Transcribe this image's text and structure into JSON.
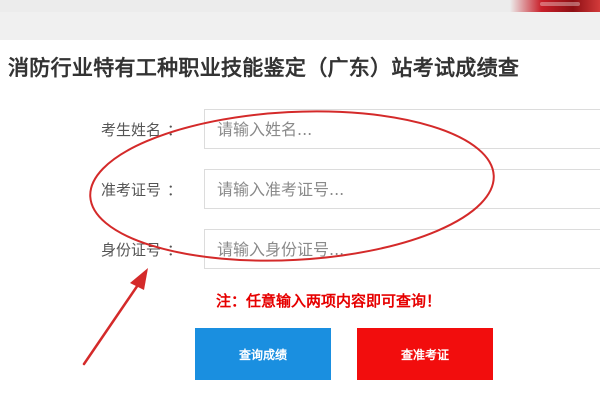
{
  "header": {
    "title": "消防行业特有工种职业技能鉴定（广东）站考试成绩查"
  },
  "form": {
    "fields": [
      {
        "label": "考生姓名",
        "colon": "：",
        "placeholder": "请输入姓名..."
      },
      {
        "label": "准考证号",
        "colon": "：",
        "placeholder": "请输入准考证号..."
      },
      {
        "label": "身份证号",
        "colon": "：",
        "placeholder": "请输入身份证号..."
      }
    ],
    "note": "注：任意输入两项内容即可查询！"
  },
  "buttons": {
    "query_score": "查询成绩",
    "query_ticket": "查准考证"
  },
  "colors": {
    "query_score_bg": "#1a8fe0",
    "query_ticket_bg": "#f20d0d",
    "note_text": "#e60000",
    "annotation": "#d42a2a"
  }
}
